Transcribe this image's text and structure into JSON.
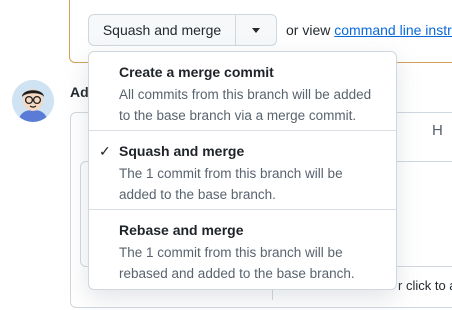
{
  "merge": {
    "button_label": "Squash and merge",
    "or_view_text": "or view",
    "command_line_link": "command line instructions"
  },
  "comment": {
    "heading": "Add a comment",
    "tab_h": "H",
    "footer_text": "r click to a"
  },
  "dropdown": {
    "items": [
      {
        "title": "Create a merge commit",
        "description": "All commits from this branch will be added to the base branch via a merge commit.",
        "selected": false
      },
      {
        "title": "Squash and merge",
        "description": "The 1 commit from this branch will be added to the base branch.",
        "selected": true
      },
      {
        "title": "Rebase and merge",
        "description": "The 1 commit from this branch will be rebased and added to the base branch.",
        "selected": false
      }
    ],
    "check_glyph": "✓"
  }
}
